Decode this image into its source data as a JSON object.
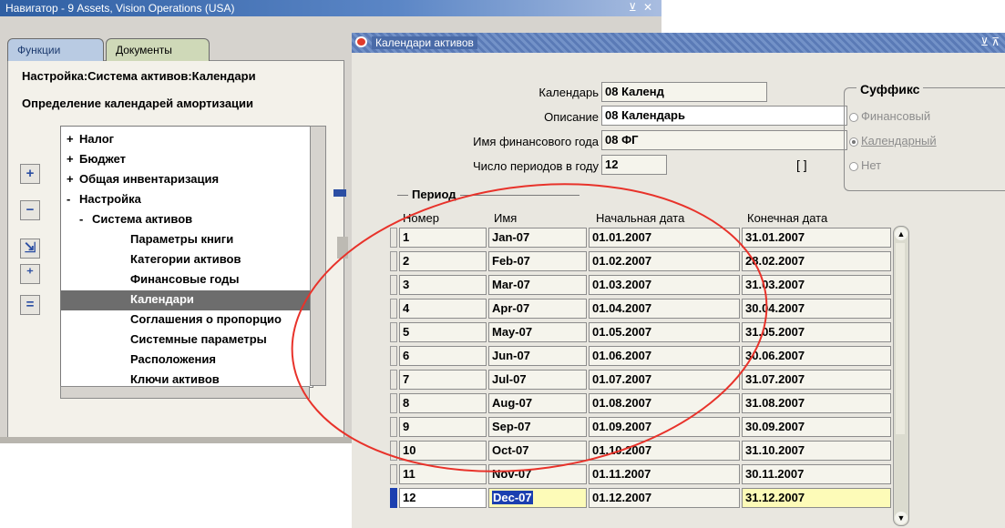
{
  "navigator": {
    "title": "Навигатор - 9 Assets, Vision Operations (USA)",
    "controls": "⊻ ✕",
    "tabs": [
      "Функции",
      "Документы"
    ],
    "breadcrumb": "Настройка:Система активов:Календари",
    "subtitle": "Определение календарей амортизации",
    "tree": [
      {
        "sym": "+",
        "label": "Налог",
        "indent": 0
      },
      {
        "sym": "+",
        "label": "Бюджет",
        "indent": 0
      },
      {
        "sym": "+",
        "label": "Общая инвентаризация",
        "indent": 0
      },
      {
        "sym": "-",
        "label": "Настройка",
        "indent": 0
      },
      {
        "sym": "-",
        "label": "Система активов",
        "indent": 1
      },
      {
        "sym": "",
        "label": "Параметры книги",
        "indent": 2
      },
      {
        "sym": "",
        "label": "Категории активов",
        "indent": 2
      },
      {
        "sym": "",
        "label": "Финансовые годы",
        "indent": 2
      },
      {
        "sym": "",
        "label": "Календари",
        "indent": 2,
        "selected": true
      },
      {
        "sym": "",
        "label": "Соглашения о пропорцио",
        "indent": 2
      },
      {
        "sym": "",
        "label": "Системные параметры",
        "indent": 2
      },
      {
        "sym": "",
        "label": "Расположения",
        "indent": 2
      },
      {
        "sym": "",
        "label": "Ключи активов",
        "indent": 2
      }
    ],
    "side_buttons": [
      {
        "name": "expand-button",
        "glyph": "+"
      },
      {
        "name": "collapse-button",
        "glyph": "−"
      },
      {
        "name": "expand-branch-button",
        "glyph": "⇲"
      },
      {
        "name": "expand-all-button",
        "glyph": "⁺"
      },
      {
        "name": "collapse-all-button",
        "glyph": "="
      }
    ]
  },
  "calendar": {
    "title": "Календари активов",
    "controls": "⊻ ⊼",
    "fields": {
      "calendar_label": "Календарь",
      "calendar_value": "08 Календ",
      "description_label": "Описание",
      "description_value": "08 Календарь",
      "fiscal_year_label": "Имя финансового года",
      "fiscal_year_value": "08 ФГ",
      "periods_label": "Число периодов в году",
      "periods_value": "12",
      "bracket": "[   ]"
    },
    "suffix": {
      "title": "Суффикс",
      "options": [
        {
          "label": "Финансовый",
          "checked": false
        },
        {
          "label": "Календарный",
          "checked": true
        },
        {
          "label": "Нет",
          "checked": false
        }
      ]
    },
    "period": {
      "title": "Период",
      "headers": [
        "Номер",
        "Имя",
        "Начальная дата",
        "Конечная дата"
      ],
      "rows": [
        [
          "1",
          "Jan-07",
          "01.01.2007",
          "31.01.2007"
        ],
        [
          "2",
          "Feb-07",
          "01.02.2007",
          "28.02.2007"
        ],
        [
          "3",
          "Mar-07",
          "01.03.2007",
          "31.03.2007"
        ],
        [
          "4",
          "Apr-07",
          "01.04.2007",
          "30.04.2007"
        ],
        [
          "5",
          "May-07",
          "01.05.2007",
          "31.05.2007"
        ],
        [
          "6",
          "Jun-07",
          "01.06.2007",
          "30.06.2007"
        ],
        [
          "7",
          "Jul-07",
          "01.07.2007",
          "31.07.2007"
        ],
        [
          "8",
          "Aug-07",
          "01.08.2007",
          "31.08.2007"
        ],
        [
          "9",
          "Sep-07",
          "01.09.2007",
          "30.09.2007"
        ],
        [
          "10",
          "Oct-07",
          "01.10.2007",
          "31.10.2007"
        ],
        [
          "11",
          "Nov-07",
          "01.11.2007",
          "30.11.2007"
        ],
        [
          "12",
          "Dec-07",
          "01.12.2007",
          "31.12.2007"
        ]
      ],
      "current_row": 11
    },
    "annotation_color": "#e8322a"
  }
}
